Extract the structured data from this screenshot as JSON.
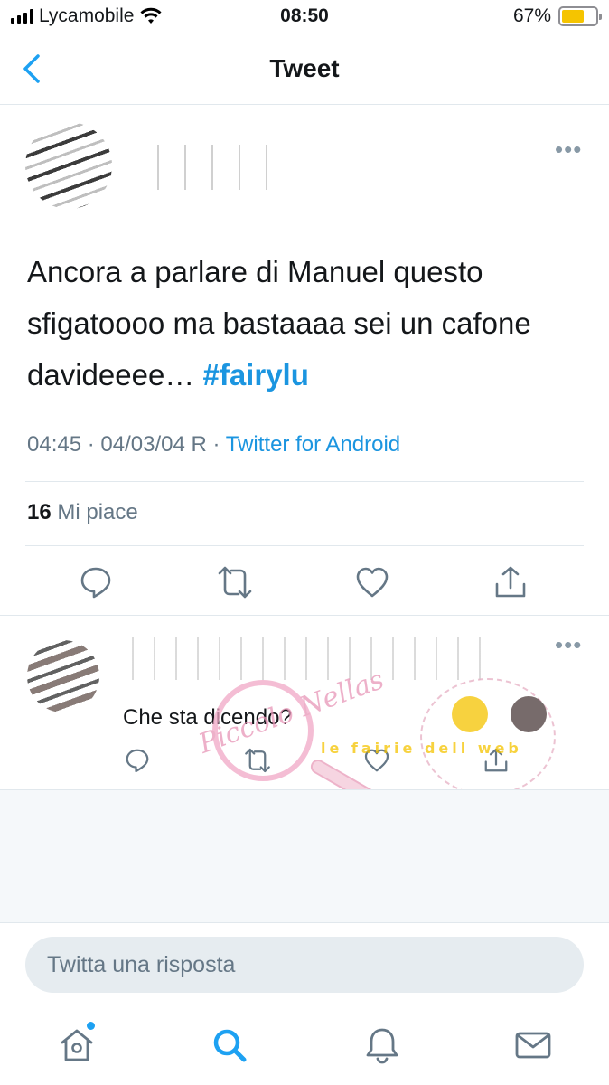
{
  "status_bar": {
    "carrier": "Lycamobile",
    "time": "08:50",
    "battery_percent": "67%",
    "battery_level": 0.67,
    "battery_color": "#f5c400"
  },
  "nav": {
    "back_icon": "chevron-left-icon",
    "title": "Tweet"
  },
  "tweet": {
    "text_plain": "Ancora a parlare di Manuel questo sfigatoooo ma bastaaaa sei un cafone davideeee…",
    "hashtag": "#fairylu",
    "time": "04:45",
    "date": "04/03/04 R",
    "separator": "·",
    "source": "Twitter for Android",
    "likes_count": "16",
    "likes_label": "Mi piace",
    "more_label": "•••"
  },
  "reply": {
    "text": "Che sta dicendo?",
    "more_label": "•••"
  },
  "watermark": {
    "script_text": "Piccolo Nellas",
    "band_text": "le fairie dell web"
  },
  "reply_box": {
    "placeholder": "Twitta una risposta"
  },
  "colors": {
    "accent": "#1b95e0",
    "secondary_text": "#657786",
    "divider": "#e1e8ed"
  }
}
